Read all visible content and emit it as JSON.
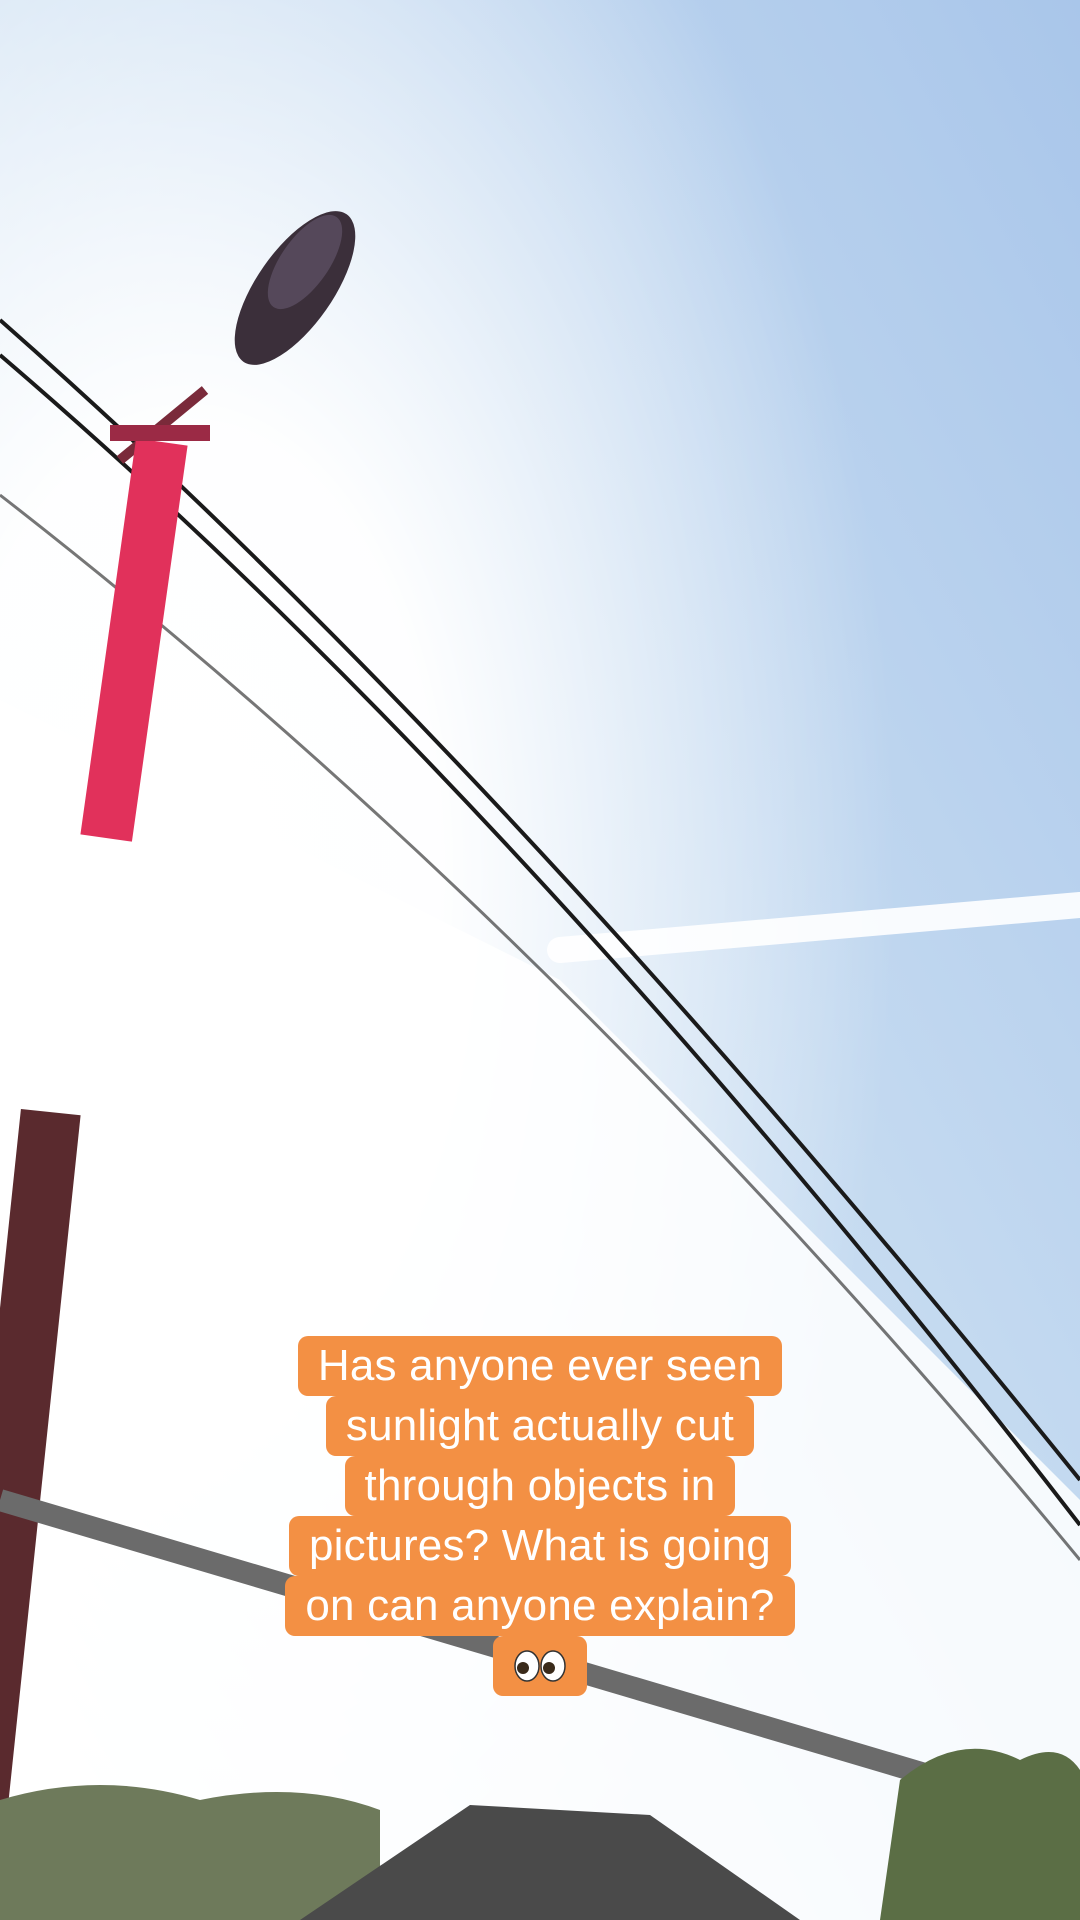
{
  "caption": {
    "lines": [
      "Has anyone ever seen",
      "sunlight actually cut",
      "through objects in",
      "pictures? What is going",
      "on can anyone explain?"
    ],
    "emoji": "eyes-emoji",
    "background_color": "#f39044",
    "text_color": "#ffffff"
  },
  "photo": {
    "description_icons": [
      "street-lamp",
      "power-lines",
      "sun-glare",
      "contrail",
      "metal-pole",
      "rooftop",
      "trees"
    ]
  }
}
